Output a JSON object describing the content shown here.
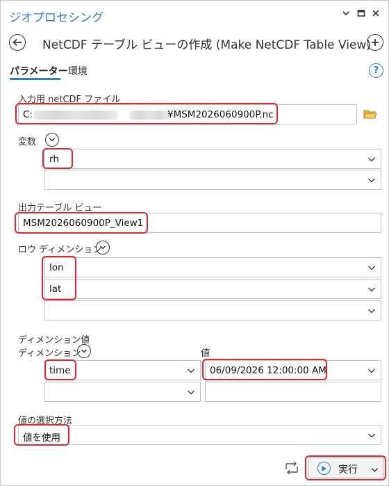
{
  "pane": {
    "title": "ジオプロセシング",
    "window_icons": [
      "chevron-down-icon",
      "restore-icon",
      "close-icon"
    ]
  },
  "tool": {
    "title": "NetCDF テーブル ビューの作成 (Make NetCDF Table View)",
    "back_icon": "back-arrow-icon",
    "add_icon": "plus-circle-icon"
  },
  "tabs": {
    "parameters": "パラメーター",
    "environments": "環境",
    "help_icon": "question-circle-icon",
    "accent_color": "#2f7fc1"
  },
  "params": {
    "input_label": "入力用 netCDF ファイル",
    "input_prefix": "C:",
    "input_suffix": "¥MSM2026060900P.nc",
    "variables_label": "変数",
    "variables": [
      "rh",
      ""
    ],
    "output_label": "出力テーブル ビュー",
    "output_value": "MSM2026060900P_View1",
    "row_dim_label": "ロウ ディメンション",
    "row_dims": [
      "lon",
      "lat",
      ""
    ],
    "dim_values_label": "ディメンション値",
    "dim_col_label": "ディメンション",
    "value_col_label": "値",
    "dim_rows": [
      {
        "dimension": "time",
        "value": "06/09/2026 12:00:00 AM"
      },
      {
        "dimension": "",
        "value": ""
      }
    ],
    "selection_label": "値の選択方法",
    "selection_value": "値を使用"
  },
  "footer": {
    "run_label": "実行",
    "highlight_color": "#e3262e"
  }
}
